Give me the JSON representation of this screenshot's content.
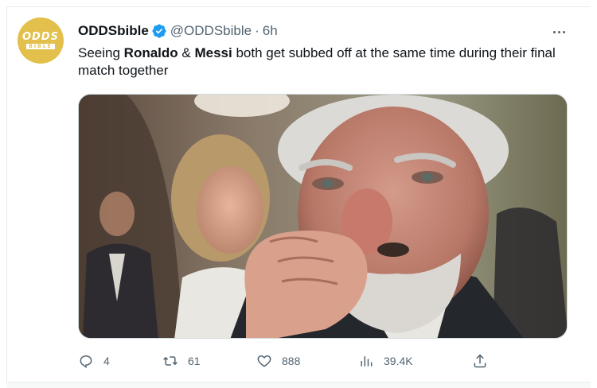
{
  "tweet": {
    "avatar": {
      "top": "ODDS",
      "bottom": "BIBLE"
    },
    "display_name": "ODDSbible",
    "handle": "@ODDSbible",
    "separator": "·",
    "time": "6h",
    "verified": true,
    "text": {
      "part1": "Seeing ",
      "bold1": "Ronaldo",
      "part2": " & ",
      "bold2": "Messi",
      "part3": " both get subbed off at the same time during their final match together"
    },
    "media": {
      "type": "image"
    },
    "actions": {
      "replies": "4",
      "retweets": "61",
      "likes": "888",
      "views": "39.4K"
    }
  },
  "colors": {
    "accent": "#1d9bf0",
    "muted": "#536471",
    "avatar_bg": "#e3c04b"
  },
  "icons": {
    "verified": "verified-badge-icon",
    "more": "more-dots-icon",
    "reply": "reply-icon",
    "retweet": "retweet-icon",
    "like": "heart-icon",
    "views": "bar-chart-icon",
    "share": "share-icon"
  }
}
